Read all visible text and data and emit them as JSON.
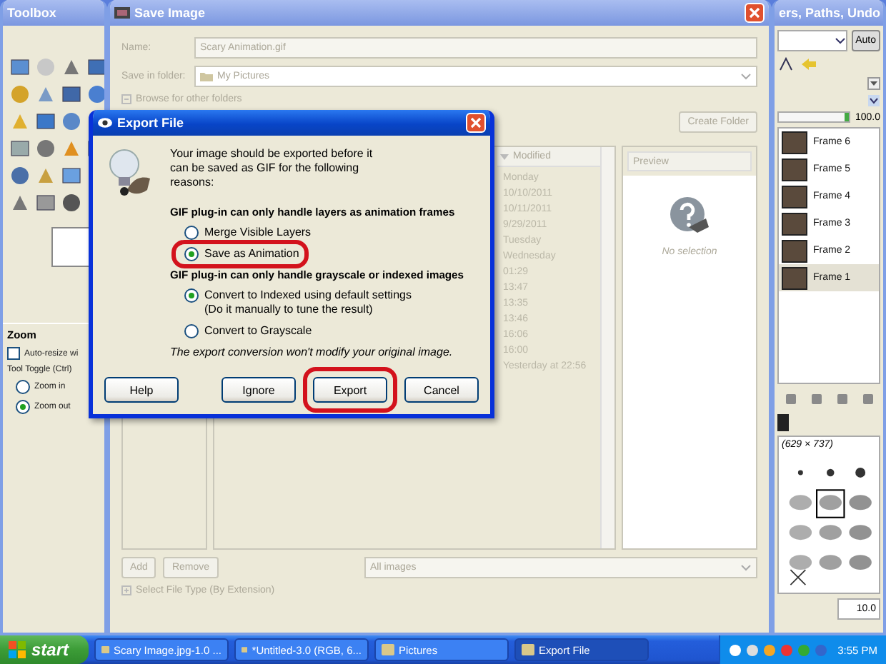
{
  "toolbox": {
    "title": "Toolbox",
    "tool_options": {
      "title": "Zoom",
      "auto_resize": {
        "label": "Auto-resize wi",
        "checked": false
      },
      "toggle_label": "Tool Toggle (Ctrl)",
      "options": [
        {
          "label": "Zoom in",
          "selected": false
        },
        {
          "label": "Zoom out",
          "selected": true
        }
      ]
    }
  },
  "save_dialog": {
    "title": "Save Image",
    "name_label": "Name:",
    "name_value": "Scary Animation.gif",
    "folder_label": "Save in folder:",
    "folder_value": "My Pictures",
    "browse_label": "Browse for other folders",
    "create_folder": "Create Folder",
    "modified_header": "Modified",
    "modified": [
      "Monday",
      "10/10/2011",
      "10/11/2011",
      "9/29/2011",
      "Tuesday",
      "Wednesday",
      "01:29",
      "13:47",
      "13:35",
      "13:46",
      "16:06",
      "16:00",
      "Yesterday at 22:56"
    ],
    "preview": {
      "title": "Preview",
      "caption": "No selection"
    },
    "add": "Add",
    "remove": "Remove",
    "filter": "All images",
    "file_type_label": "Select File Type (By Extension)"
  },
  "export_dialog": {
    "title": "Export File",
    "message": "Your image should be exported before it can be saved as GIF for the following reasons:",
    "groups": [
      {
        "heading": "GIF plug-in can only handle layers as animation frames",
        "options": [
          {
            "label": "Merge Visible Layers",
            "selected": false,
            "highlighted": false
          },
          {
            "label": "Save as Animation",
            "selected": true,
            "highlighted": true
          }
        ]
      },
      {
        "heading": "GIF plug-in can only handle grayscale or indexed images",
        "options": [
          {
            "label": "Convert to Indexed using default settings",
            "note": "(Do it manually to tune the result)",
            "selected": true,
            "highlighted": false
          },
          {
            "label": "Convert to Grayscale",
            "selected": false,
            "highlighted": false
          }
        ]
      }
    ],
    "footnote": "The export conversion won't modify your original image.",
    "buttons": [
      {
        "label": "Help",
        "highlighted": false
      },
      {
        "label": "Ignore",
        "highlighted": false
      },
      {
        "label": "Export",
        "highlighted": true
      },
      {
        "label": "Cancel",
        "highlighted": false
      }
    ]
  },
  "layers_dock": {
    "title": "ers, Paths, Undo",
    "auto": "Auto",
    "opacity": {
      "reading": "100.0",
      "level": 1
    },
    "layers": [
      {
        "name": "Frame 6",
        "selected": false
      },
      {
        "name": "Frame 5",
        "selected": false
      },
      {
        "name": "Frame 4",
        "selected": false
      },
      {
        "name": "Frame 3",
        "selected": false
      },
      {
        "name": "Frame 2",
        "selected": false
      },
      {
        "name": "Frame 1",
        "selected": true
      }
    ],
    "brush_size": "(629 × 737)",
    "spacing": "10.0"
  },
  "taskbar": {
    "start": "start",
    "tasks": [
      {
        "label": "Scary Image.jpg-1.0 ...",
        "selected": false
      },
      {
        "label": "*Untitled-3.0 (RGB, 6...",
        "selected": false
      },
      {
        "label": "Pictures",
        "selected": false
      },
      {
        "label": "Export File",
        "selected": true
      }
    ],
    "clock": "3:55 PM"
  }
}
